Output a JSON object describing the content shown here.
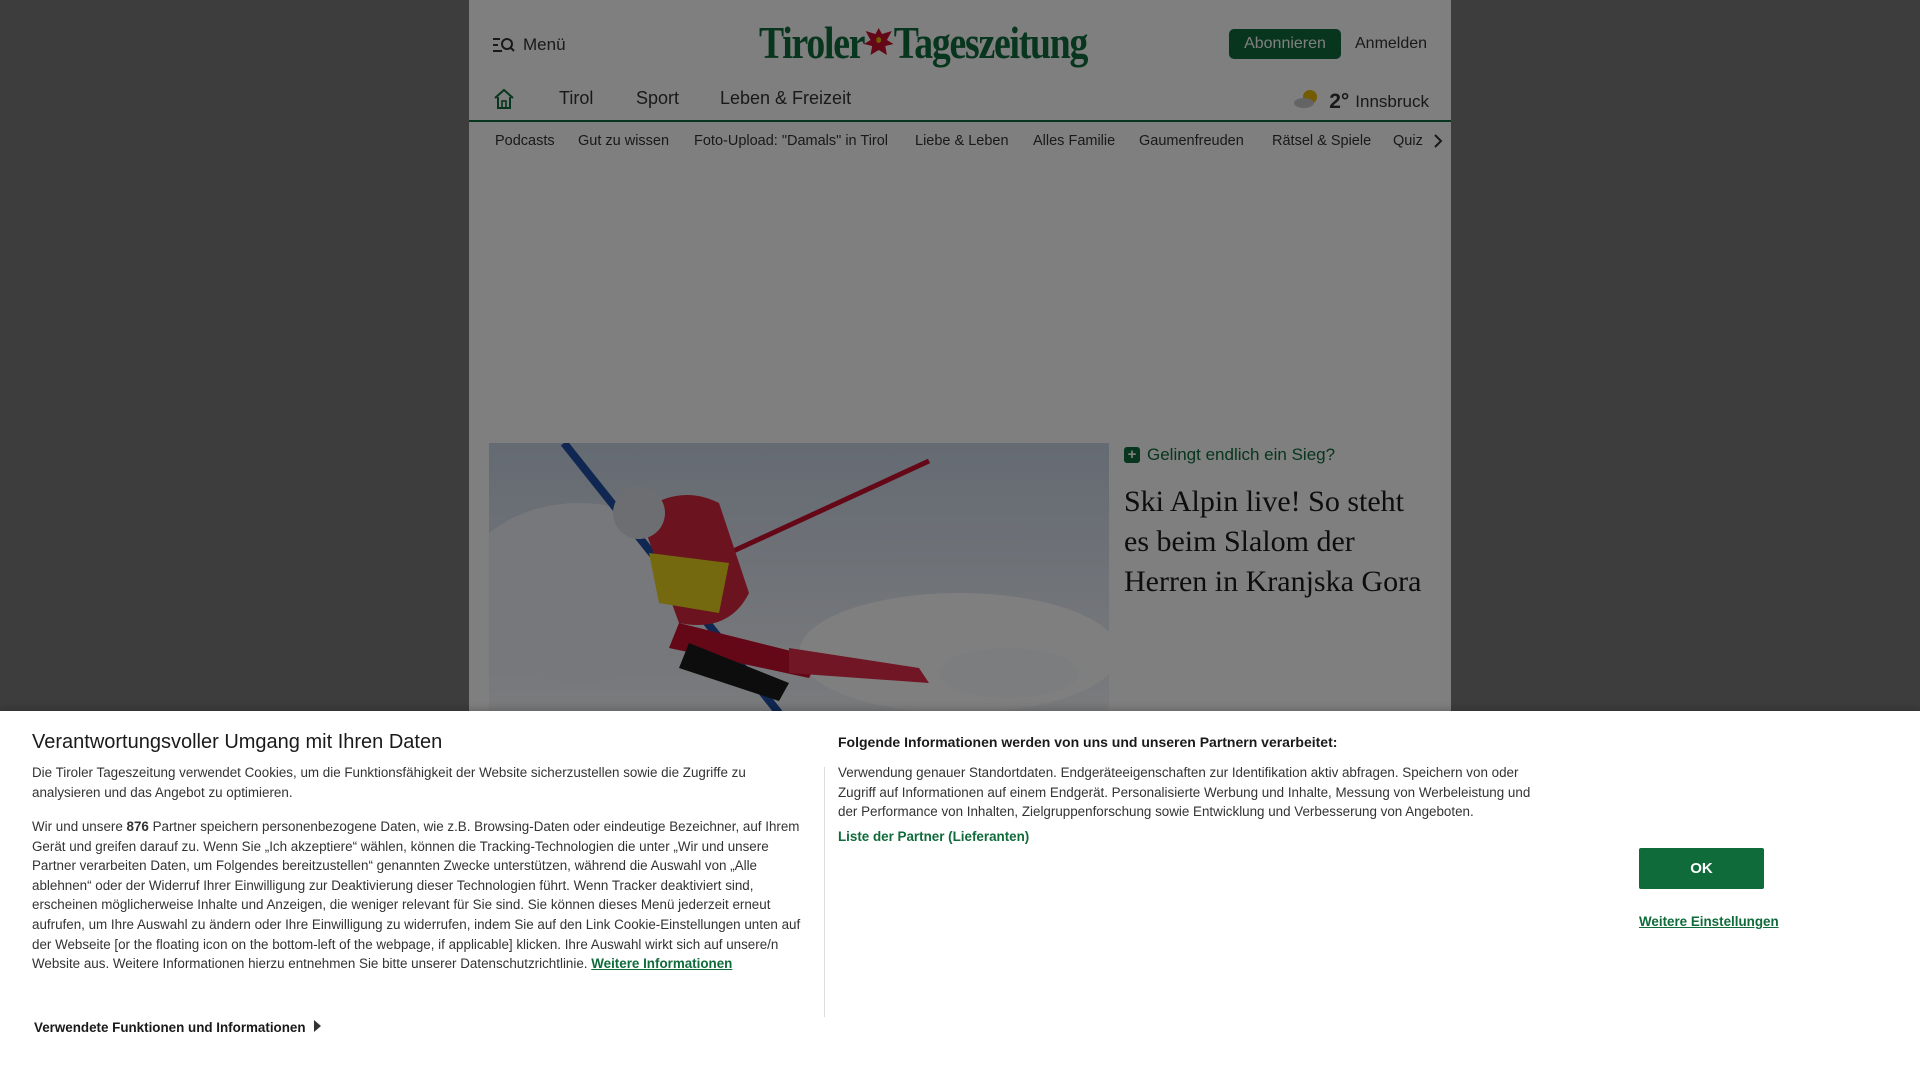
{
  "header": {
    "menu_label": "Menü",
    "logo_left": "Tiroler",
    "logo_right": "Tageszeitung",
    "subscribe_label": "Abonnieren",
    "login_label": "Anmelden"
  },
  "mainnav": {
    "items": [
      {
        "label": "Tirol"
      },
      {
        "label": "Sport"
      },
      {
        "label": "Leben & Freizeit"
      }
    ],
    "weather": {
      "temp": "2°",
      "city": "Innsbruck",
      "icon": "sun-cloud-icon"
    }
  },
  "subnav": {
    "items": [
      {
        "label": "Podcasts"
      },
      {
        "label": "Gut zu wissen"
      },
      {
        "label": "Foto-Upload: \"Damals\" in Tirol"
      },
      {
        "label": "Liebe & Leben"
      },
      {
        "label": "Alles Familie"
      },
      {
        "label": "Gaumenfreuden"
      },
      {
        "label": "Rätsel & Spiele"
      },
      {
        "label": "Quiz"
      }
    ]
  },
  "teaser": {
    "kicker": "Gelingt endlich ein Sieg?",
    "title": "Ski Alpin live! So steht es beim Slalom der Herren in Kranjska Gora"
  },
  "consent": {
    "title": "Verantwortungsvoller Umgang mit Ihren Daten",
    "text1": "Die Tiroler Tageszeitung verwendet Cookies, um die Funktionsfähigkeit der Website sicherzustellen sowie die Zugriffe zu analysieren und das Angebot zu optimieren.",
    "text2_pre": "Wir und unsere ",
    "partner_count": "876",
    "text2_post": " Partner speichern personenbezogene Daten, wie z.B. Browsing-Daten oder eindeutige Bezeichner, auf Ihrem Gerät und greifen darauf zu. Wenn Sie „Ich akzeptiere“ wählen, können die Tracking-Technologien die unter „Wir und unsere Partner verarbeiten Daten, um Folgendes bereitzustellen“ genannten Zwecke unterstützen, während die Auswahl von „Alle ablehnen“ oder der Widerruf Ihrer Einwilligung zur Deaktivierung dieser Technologien führt. Wenn Tracker deaktiviert sind, erscheinen möglicherweise Inhalte und Anzeigen, die weniger relevant für Sie sind. Sie können dieses Menü jederzeit erneut aufrufen, um Ihre Auswahl zu ändern oder Ihre Einwilligung zu widerrufen, indem Sie auf den Link Cookie-Einstellungen unten auf der Webseite [or the floating icon on the bottom-left of the webpage, if applicable] klicken. Ihre Auswahl wirkt sich auf unsere/n Website aus. Weitere Informationen hierzu entnehmen Sie bitte unserer Datenschutzrichtlinie. ",
    "more_info_link": "Weitere Informationen",
    "right_title": "Folgende Informationen werden von uns und unseren Partnern verarbeitet:",
    "right_text": "Verwendung genauer Standortdaten. Endgeräteeigenschaften zur Identifikation aktiv abfragen. Speichern von oder Zugriff auf Informationen auf einem Endgerät. Personalisierte Werbung und Inhalte, Messung von Werbeleistung und der Performance von Inhalten, Zielgruppenforschung sowie Entwicklung und Verbesserung von Angeboten.",
    "partners_link": "Liste der Partner (Lieferanten)",
    "ok_label": "OK",
    "settings_link": "Weitere Einstellungen",
    "functions_label": "Verwendete Funktionen und Informationen"
  },
  "colors": {
    "brand_green": "#0f6b3a",
    "eagle_red": "#c8102e",
    "overlay": "rgba(0,0,0,0.5)"
  }
}
